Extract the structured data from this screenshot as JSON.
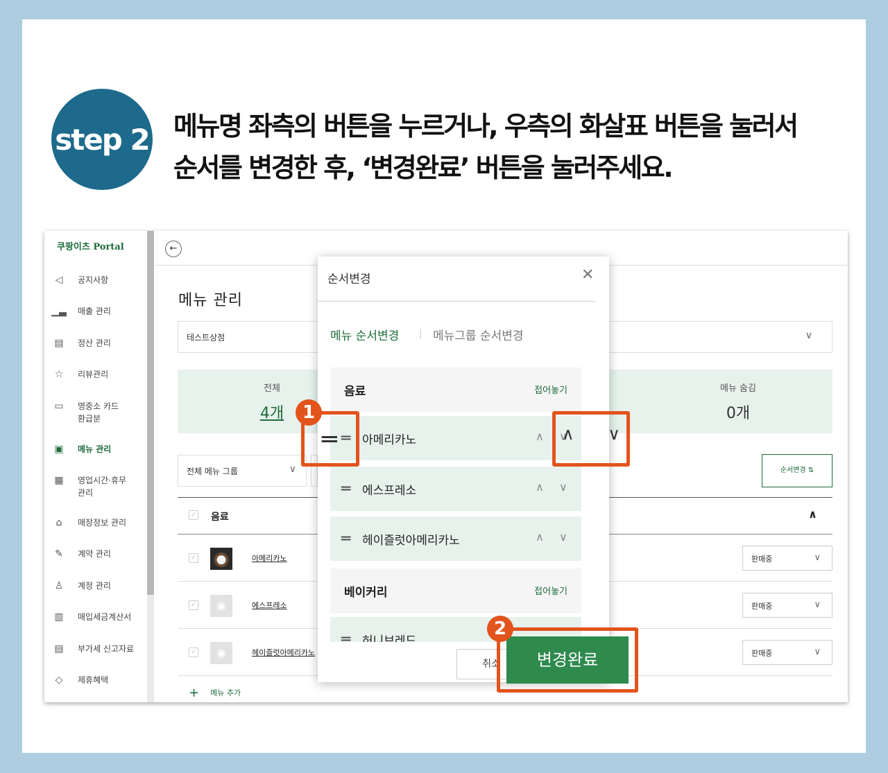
{
  "step": {
    "label": "step 2"
  },
  "instruction": {
    "line1": "메뉴명 좌측의 버튼을 누르거나, 우측의 화살표 버튼을 눌러서",
    "line2": "순서를 변경한 후, ‘변경완료’ 버튼을 눌러주세요."
  },
  "sidebar": {
    "logo": "쿠팡이츠 Portal",
    "items": [
      {
        "label": "공지사항",
        "icon": "megaphone-icon"
      },
      {
        "label": "매출 관리",
        "icon": "bar-chart-icon"
      },
      {
        "label": "정산 관리",
        "icon": "settlement-icon"
      },
      {
        "label": "리뷰관리",
        "icon": "star-icon"
      },
      {
        "label": "영중소 카드",
        "label2": "환급분",
        "icon": "card-icon"
      },
      {
        "label": "메뉴 관리",
        "icon": "menu-book-icon",
        "active": true
      },
      {
        "label": "영업시간·휴무",
        "label2": "관리",
        "icon": "calendar-icon"
      },
      {
        "label": "매장정보 관리",
        "icon": "store-icon"
      },
      {
        "label": "계약 관리",
        "icon": "contract-icon"
      },
      {
        "label": "계정 관리",
        "icon": "user-icon"
      },
      {
        "label": "매입세금계산서",
        "icon": "calculator-icon"
      },
      {
        "label": "부가세 신고자료",
        "icon": "document-icon"
      },
      {
        "label": "제휴혜택",
        "icon": "diamond-icon"
      }
    ]
  },
  "main": {
    "page_title": "메뉴 관리",
    "store": "테스트상점",
    "stats": {
      "total_label": "전체",
      "total_value": "4개",
      "hidden_label": "메뉴 숨김",
      "hidden_value": "0개"
    },
    "group_filter": "전체 메뉴 그룹",
    "order_button": "순서변경 ⇅",
    "table": {
      "group": "음료",
      "rows": [
        {
          "name": "아메리카노",
          "status": "판매중"
        },
        {
          "name": "에스프레소",
          "status": "판매중"
        },
        {
          "name": "헤이즐럿아메리카노",
          "status": "판매중"
        }
      ]
    },
    "add_menu": "메뉴 추가"
  },
  "modal": {
    "title": "순서변경",
    "tab_menu": "메뉴 순서변경",
    "tab_separator": "|",
    "tab_group": "메뉴그룹 순서변경",
    "groups": [
      {
        "name": "음료",
        "fold": "접어놓기",
        "items": [
          "아메리카노",
          "에스프레소",
          "헤이즐럿아메리카노"
        ]
      },
      {
        "name": "베이커리",
        "fold": "접어놓기",
        "items": [
          "허니브레드"
        ]
      }
    ],
    "cancel": "취소",
    "confirm": "변경완료"
  },
  "callouts": {
    "one": "1",
    "two": "2"
  },
  "colors": {
    "accent": "#1d6b3a",
    "highlight": "#e2541c",
    "badge": "#1d6a8c",
    "frame": "#aecde0"
  }
}
